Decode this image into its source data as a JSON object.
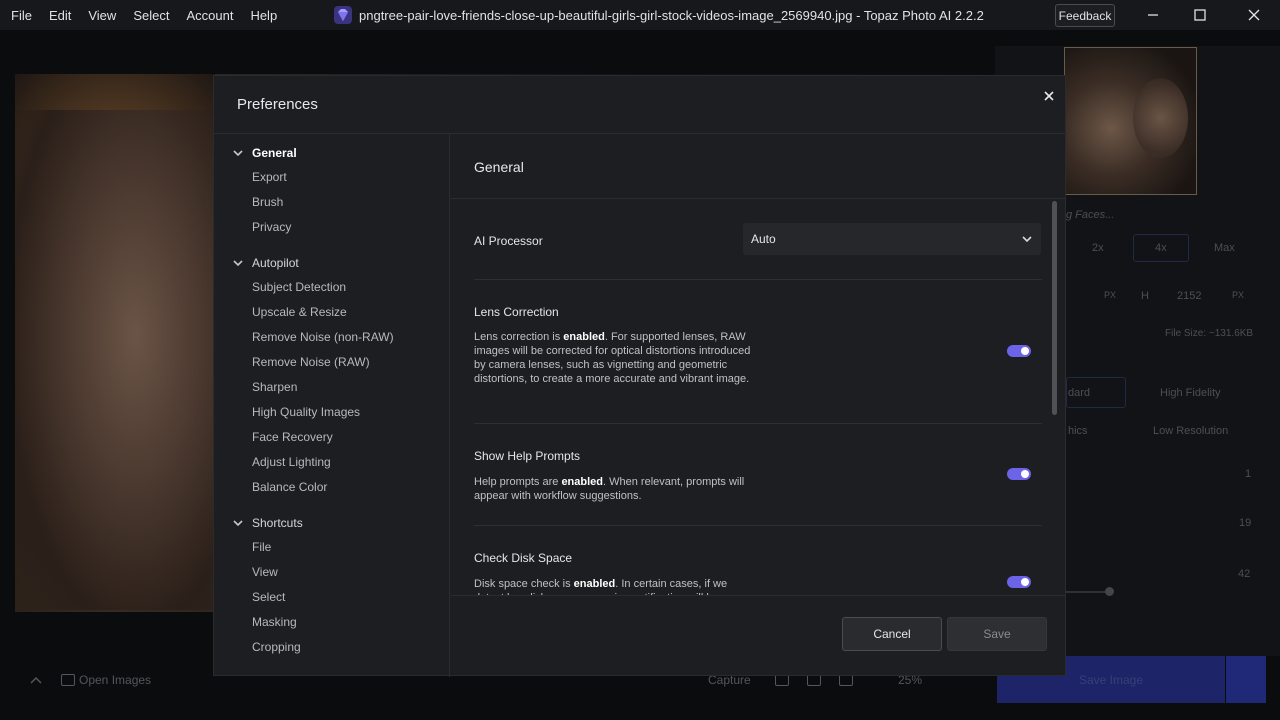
{
  "menu": [
    "File",
    "Edit",
    "View",
    "Select",
    "Account",
    "Help"
  ],
  "window_title": "pngtree-pair-love-friends-close-up-beautiful-girls-girl-stock-videos-image_2569940.jpg - Topaz Photo AI 2.2.2",
  "feedback_label": "Feedback",
  "background": {
    "faces_label": "g Faces...",
    "scale_options": [
      "2x",
      "4x",
      "Max"
    ],
    "height_label": "H",
    "height_value": "2152",
    "px_unit": "PX",
    "file_size": "File Size: ~131.6KB",
    "model_options": [
      "dard",
      "High Fidelity",
      "hics",
      "Low Resolution"
    ],
    "values": [
      "1",
      "19",
      "42"
    ],
    "save_image_label": "Save Image",
    "open_images_label": "Open Images",
    "capture_label": "Capture",
    "zoom_label": "25%"
  },
  "modal": {
    "title": "Preferences",
    "sidebar": {
      "groups": [
        {
          "label": "General",
          "items": [
            "Export",
            "Brush",
            "Privacy"
          ]
        },
        {
          "label": "Autopilot",
          "items": [
            "Subject Detection",
            "Upscale & Resize",
            "Remove Noise (non-RAW)",
            "Remove Noise (RAW)",
            "Sharpen",
            "High Quality Images",
            "Face Recovery",
            "Adjust Lighting",
            "Balance Color"
          ]
        },
        {
          "label": "Shortcuts",
          "items": [
            "File",
            "View",
            "Select",
            "Masking",
            "Cropping"
          ]
        }
      ]
    },
    "content": {
      "title": "General",
      "ai_processor": {
        "label": "AI Processor",
        "value": "Auto"
      },
      "lens_correction": {
        "label": "Lens Correction",
        "desc_before": "Lens correction is ",
        "desc_bold": "enabled",
        "desc_after": ". For supported lenses, RAW images will be corrected for optical distortions introduced by camera lenses, such as vignetting and geometric distortions, to create a more accurate and vibrant image."
      },
      "help_prompts": {
        "label": "Show Help Prompts",
        "desc_before": "Help prompts are ",
        "desc_bold": "enabled",
        "desc_after": ". When relevant, prompts will appear with workflow suggestions."
      },
      "disk_space": {
        "label": "Check Disk Space",
        "desc_before": "Disk space check is ",
        "desc_bold": "enabled",
        "desc_after": ". In certain cases, if we detect low disk space a warning notification will be"
      }
    },
    "cancel_label": "Cancel",
    "save_label": "Save"
  },
  "colors": {
    "accent": "#6b63e8",
    "modal_bg": "#1d1e21",
    "titlebar_bg": "#17181b"
  }
}
